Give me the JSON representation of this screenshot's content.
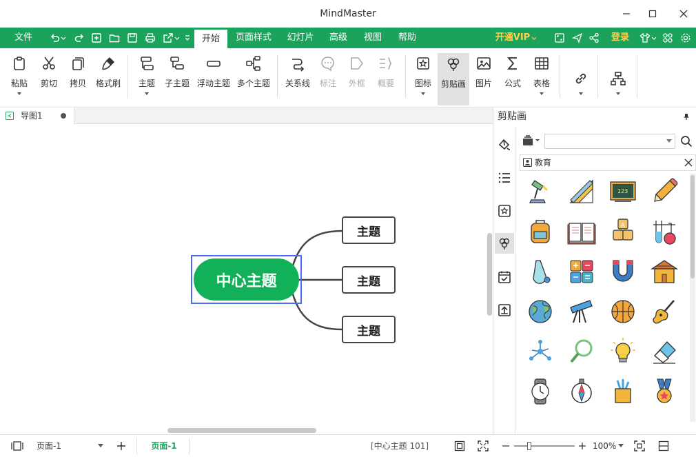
{
  "app": {
    "title": "MindMaster"
  },
  "menubar": {
    "file": "文件",
    "tabs": [
      "开始",
      "页面样式",
      "幻灯片",
      "高级",
      "视图",
      "帮助"
    ],
    "vip": "开通VIP",
    "login": "登录"
  },
  "ribbon": {
    "paste": "粘贴",
    "cut": "剪切",
    "copy": "拷贝",
    "format_painter": "格式刷",
    "topic": "主题",
    "subtopic": "子主题",
    "floating_topic": "浮动主题",
    "multiple_topics": "多个主题",
    "relationship": "关系线",
    "callout": "标注",
    "boundary": "外框",
    "summary": "概要",
    "icon": "图标",
    "clipart": "剪贴画",
    "picture": "图片",
    "formula": "公式",
    "table": "表格"
  },
  "doc_tab": {
    "name": "导图1"
  },
  "mindmap": {
    "central": "中心主题",
    "topics": [
      "主题",
      "主题",
      "主题"
    ]
  },
  "panel": {
    "title": "剪贴画",
    "category": "教育",
    "search_placeholder": "",
    "items": [
      "desk-lamp",
      "ruler-triangle",
      "blackboard",
      "pencil",
      "backpack",
      "open-book",
      "abc-blocks",
      "test-tubes",
      "bottle",
      "calculator",
      "magnet",
      "school",
      "globe",
      "telescope",
      "basketball",
      "guitar",
      "molecule",
      "magnifier",
      "light-bulb",
      "eraser",
      "stopwatch",
      "compass",
      "pencil-cup",
      "medal"
    ]
  },
  "status": {
    "page_select": "页面-1",
    "page_tab": "页面-1",
    "selection": "[中心主题 101]",
    "zoom": "100%"
  },
  "colors": {
    "brand": "#1ca35b",
    "vip": "#ffd24a",
    "node": "#13b05a",
    "select": "#4a6cf0"
  }
}
